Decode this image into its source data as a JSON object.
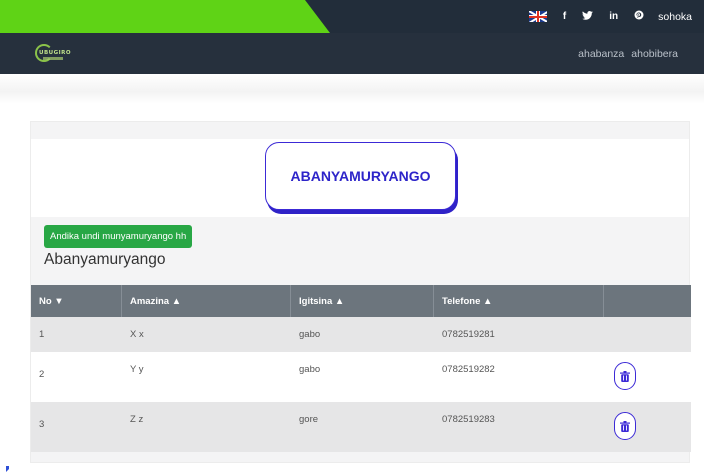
{
  "social": {
    "flag_icon": "uk-flag-icon",
    "facebook": "f",
    "twitter": "twitter-icon",
    "linkedin": "in",
    "pinterest": "pinterest-icon",
    "login_label": "sohoka"
  },
  "nav": {
    "logo_text": "UBUGIRO",
    "links": [
      "ahabanza",
      "ahobibera"
    ]
  },
  "page": {
    "title": "ABANYAMURYANGO",
    "add_button_label": "Andika undi munyamuryango hh",
    "section_title": "Abanyamuryango"
  },
  "table": {
    "headers": [
      "No ▼",
      "Amazina ▲",
      "Igitsina ▲",
      "Telefone ▲",
      ""
    ],
    "rows": [
      {
        "no": "1",
        "name": "X x",
        "gender": "gabo",
        "phone": "0782519281",
        "delete": false
      },
      {
        "no": "2",
        "name": "Y y",
        "gender": "gabo",
        "phone": "0782519282",
        "delete": true
      },
      {
        "no": "3",
        "name": "Z z",
        "gender": "gore",
        "phone": "0782519283",
        "delete": true
      }
    ]
  },
  "colors": {
    "green_accent": "#5fd316",
    "dark_bar": "#222d3a",
    "title_blue": "#2d24c9",
    "button_green": "#28a745",
    "table_header": "#6c757d"
  }
}
